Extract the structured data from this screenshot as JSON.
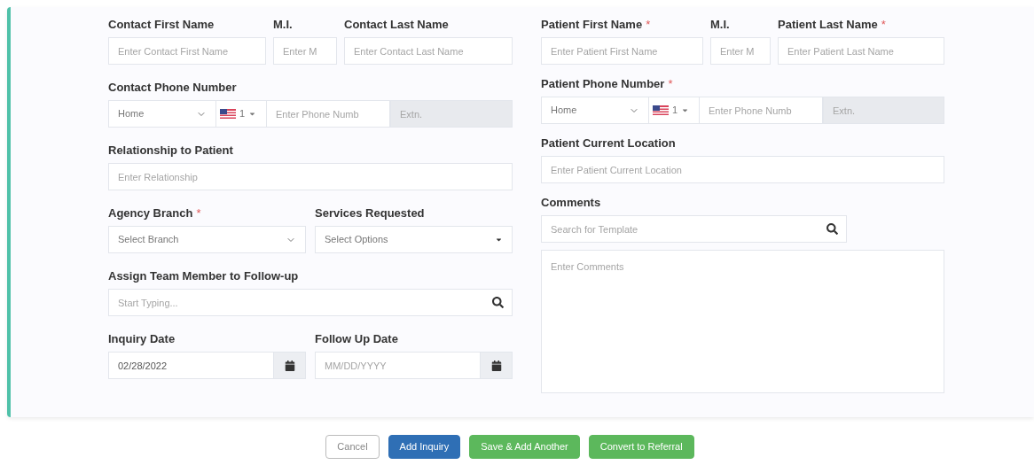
{
  "contact": {
    "names": [
      {
        "label": "Contact First Name",
        "placeholder": "Enter Contact First Name"
      },
      {
        "label": "M.I.",
        "placeholder": "Enter M"
      },
      {
        "label": "Contact Last Name",
        "placeholder": "Enter Contact Last Name"
      }
    ],
    "phone": {
      "label": "Contact Phone Number",
      "type": "Home",
      "code": "1",
      "placeholder": "Enter Phone Numb",
      "ext_placeholder": "Extn.",
      "ext_disabled": true
    },
    "relationship": {
      "label": "Relationship to Patient",
      "placeholder": "Enter Relationship"
    },
    "branch": {
      "label": "Agency Branch",
      "required_mark": "*",
      "placeholder": "Select Branch"
    },
    "services": {
      "label": "Services Requested",
      "placeholder": "Select Options"
    },
    "team_member": {
      "label": "Assign Team Member to Follow-up",
      "placeholder": "Start Typing..."
    },
    "inquiry_date": {
      "label": "Inquiry Date",
      "value": "02/28/2022"
    },
    "follow_up_date": {
      "label": "Follow Up Date",
      "placeholder": "MM/DD/YYYY"
    }
  },
  "patient": {
    "names": [
      {
        "label": "Patient First Name",
        "required_mark": "*",
        "placeholder": "Enter Patient First Name"
      },
      {
        "label": "M.I.",
        "placeholder": "Enter M"
      },
      {
        "label": "Patient Last Name",
        "required_mark": "*",
        "placeholder": "Enter Patient Last Name"
      }
    ],
    "phone": {
      "label": "Patient Phone Number",
      "required_mark": "*",
      "type": "Home",
      "code": "1",
      "placeholder": "Enter Phone Numb",
      "ext_placeholder": "Extn.",
      "ext_disabled": true
    },
    "location": {
      "label": "Patient Current Location",
      "placeholder": "Enter Patient Current Location"
    },
    "comments": {
      "label": "Comments",
      "template_placeholder": "Search for Template",
      "placeholder": "Enter Comments"
    }
  },
  "buttons": [
    {
      "label": "Cancel",
      "kind": "outline"
    },
    {
      "label": "Add Inquiry",
      "kind": "primary"
    },
    {
      "label": "Save & Add Another",
      "kind": "success"
    },
    {
      "label": "Convert to Referral",
      "kind": "success"
    }
  ]
}
